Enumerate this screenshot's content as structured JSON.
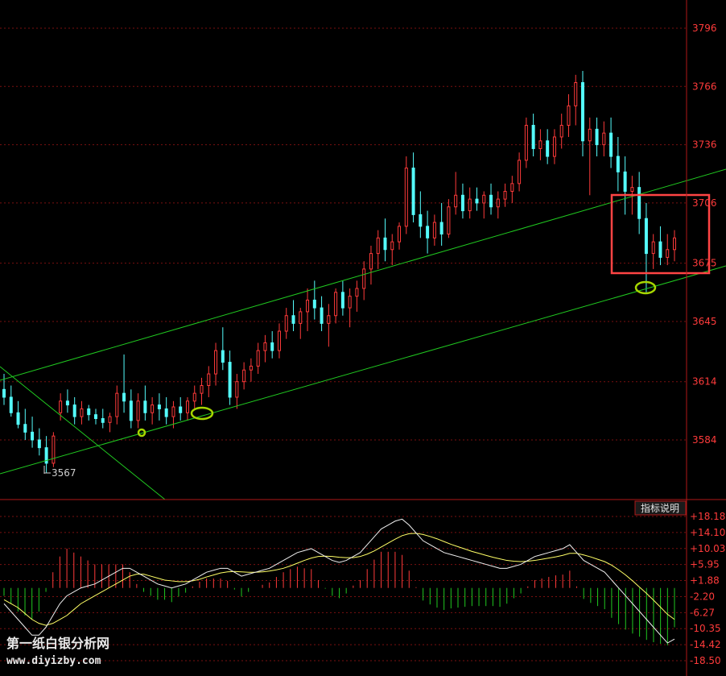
{
  "chart_data": [
    {
      "type": "candlestick",
      "title": "",
      "ylim": [
        3550,
        3810
      ],
      "grid": true,
      "y_ticks": [
        "3796",
        "3766",
        "3736",
        "3706",
        "3675",
        "3645",
        "3614",
        "3584"
      ],
      "low_marker": "3567",
      "colors": {
        "up": "#ff3a3a",
        "down": "#54fcfc",
        "channel": "#20c820",
        "highlight": "#ff4444",
        "circle": "#a6d600",
        "axis_text": "#ff3b3b"
      },
      "candles": [
        [
          3610,
          3618,
          3602,
          3606
        ],
        [
          3606,
          3612,
          3596,
          3598
        ],
        [
          3598,
          3604,
          3590,
          3592
        ],
        [
          3592,
          3600,
          3584,
          3588
        ],
        [
          3588,
          3596,
          3580,
          3584
        ],
        [
          3584,
          3590,
          3576,
          3580
        ],
        [
          3580,
          3586,
          3567,
          3572
        ],
        [
          3572,
          3588,
          3570,
          3586
        ],
        [
          3598,
          3608,
          3594,
          3604
        ],
        [
          3604,
          3610,
          3598,
          3602
        ],
        [
          3602,
          3606,
          3592,
          3596
        ],
        [
          3596,
          3604,
          3592,
          3600
        ],
        [
          3600,
          3602,
          3594,
          3597
        ],
        [
          3597,
          3600,
          3592,
          3595
        ],
        [
          3595,
          3600,
          3590,
          3593
        ],
        [
          3593,
          3598,
          3588,
          3596
        ],
        [
          3596,
          3612,
          3592,
          3608
        ],
        [
          3608,
          3628,
          3598,
          3604
        ],
        [
          3604,
          3610,
          3590,
          3594
        ],
        [
          3594,
          3608,
          3590,
          3604
        ],
        [
          3604,
          3612,
          3594,
          3598
        ],
        [
          3598,
          3606,
          3592,
          3602
        ],
        [
          3602,
          3608,
          3594,
          3600
        ],
        [
          3600,
          3606,
          3592,
          3596
        ],
        [
          3596,
          3604,
          3590,
          3601
        ],
        [
          3601,
          3606,
          3594,
          3598
        ],
        [
          3598,
          3606,
          3594,
          3604
        ],
        [
          3604,
          3612,
          3600,
          3608
        ],
        [
          3608,
          3616,
          3602,
          3612
        ],
        [
          3612,
          3622,
          3606,
          3618
        ],
        [
          3618,
          3634,
          3612,
          3630
        ],
        [
          3630,
          3642,
          3620,
          3624
        ],
        [
          3624,
          3630,
          3602,
          3606
        ],
        [
          3606,
          3618,
          3600,
          3614
        ],
        [
          3614,
          3624,
          3610,
          3620
        ],
        [
          3620,
          3626,
          3614,
          3622
        ],
        [
          3622,
          3634,
          3618,
          3630
        ],
        [
          3630,
          3638,
          3624,
          3634
        ],
        [
          3634,
          3640,
          3626,
          3630
        ],
        [
          3630,
          3644,
          3626,
          3640
        ],
        [
          3640,
          3652,
          3636,
          3648
        ],
        [
          3648,
          3656,
          3640,
          3644
        ],
        [
          3644,
          3652,
          3636,
          3650
        ],
        [
          3650,
          3662,
          3640,
          3656
        ],
        [
          3656,
          3666,
          3646,
          3652
        ],
        [
          3652,
          3658,
          3640,
          3644
        ],
        [
          3644,
          3654,
          3632,
          3648
        ],
        [
          3648,
          3662,
          3644,
          3660
        ],
        [
          3660,
          3666,
          3648,
          3652
        ],
        [
          3652,
          3662,
          3642,
          3658
        ],
        [
          3658,
          3666,
          3650,
          3662
        ],
        [
          3662,
          3676,
          3656,
          3672
        ],
        [
          3672,
          3684,
          3664,
          3680
        ],
        [
          3680,
          3692,
          3672,
          3688
        ],
        [
          3688,
          3698,
          3676,
          3682
        ],
        [
          3682,
          3690,
          3674,
          3686
        ],
        [
          3686,
          3696,
          3682,
          3694
        ],
        [
          3694,
          3730,
          3690,
          3724
        ],
        [
          3724,
          3732,
          3696,
          3700
        ],
        [
          3700,
          3712,
          3688,
          3694
        ],
        [
          3694,
          3702,
          3680,
          3688
        ],
        [
          3688,
          3700,
          3684,
          3696
        ],
        [
          3696,
          3706,
          3684,
          3690
        ],
        [
          3690,
          3708,
          3688,
          3704
        ],
        [
          3704,
          3722,
          3700,
          3710
        ],
        [
          3710,
          3716,
          3698,
          3702
        ],
        [
          3702,
          3714,
          3698,
          3708
        ],
        [
          3708,
          3714,
          3702,
          3706
        ],
        [
          3706,
          3712,
          3698,
          3710
        ],
        [
          3710,
          3716,
          3700,
          3704
        ],
        [
          3704,
          3712,
          3698,
          3708
        ],
        [
          3708,
          3716,
          3704,
          3712
        ],
        [
          3712,
          3720,
          3706,
          3716
        ],
        [
          3716,
          3732,
          3712,
          3728
        ],
        [
          3728,
          3750,
          3724,
          3746
        ],
        [
          3746,
          3752,
          3730,
          3734
        ],
        [
          3734,
          3744,
          3728,
          3738
        ],
        [
          3738,
          3744,
          3726,
          3730
        ],
        [
          3730,
          3744,
          3726,
          3740
        ],
        [
          3740,
          3752,
          3734,
          3746
        ],
        [
          3746,
          3762,
          3740,
          3756
        ],
        [
          3756,
          3772,
          3746,
          3768
        ],
        [
          3768,
          3774,
          3730,
          3738
        ],
        [
          3738,
          3750,
          3710,
          3744
        ],
        [
          3744,
          3750,
          3730,
          3736
        ],
        [
          3736,
          3748,
          3730,
          3742
        ],
        [
          3742,
          3750,
          3724,
          3730
        ],
        [
          3730,
          3740,
          3712,
          3722
        ],
        [
          3722,
          3730,
          3700,
          3712
        ],
        [
          3712,
          3720,
          3700,
          3714
        ],
        [
          3714,
          3722,
          3690,
          3698
        ],
        [
          3698,
          3706,
          3660,
          3680
        ],
        [
          3680,
          3690,
          3672,
          3686
        ],
        [
          3686,
          3694,
          3674,
          3678
        ],
        [
          3678,
          3690,
          3674,
          3682
        ],
        [
          3682,
          3692,
          3676,
          3688
        ]
      ]
    },
    {
      "type": "macd",
      "ylim": [
        -18.5,
        18.18
      ],
      "y_ticks": [
        "+18.18",
        "+14.10",
        "+10.03",
        "+5.95",
        "+1.88",
        "-2.20",
        "-6.27",
        "-10.35",
        "-14.42",
        "-18.50"
      ],
      "button_label": "指标说明",
      "colors": {
        "pos": "#ff3a3a",
        "neg": "#20c820",
        "dif": "#f0f0f0",
        "dea": "#ffff66",
        "axis_text": "#ff3b3b"
      },
      "dif": [
        -4,
        -6,
        -8,
        -10,
        -12,
        -12,
        -10,
        -7,
        -4,
        -2,
        -1,
        0,
        0.5,
        1,
        2,
        3,
        4,
        5,
        5,
        4,
        3,
        2,
        1,
        0.5,
        0,
        0.5,
        1,
        2,
        3,
        4,
        4.5,
        5,
        5,
        4,
        3,
        3.5,
        4,
        4.5,
        5,
        6,
        7,
        8,
        9,
        9.5,
        10,
        9,
        8,
        7,
        6.5,
        7,
        8,
        9,
        11,
        13,
        15,
        16,
        17,
        17.5,
        16,
        14,
        12,
        11,
        10,
        9,
        8.5,
        8,
        7.5,
        7,
        6.5,
        6,
        5.5,
        5,
        5,
        5.5,
        6,
        7,
        8,
        8.5,
        9,
        9.5,
        10,
        11,
        9,
        7,
        6,
        5,
        4,
        2,
        0,
        -2,
        -4,
        -6,
        -8,
        -10,
        -12,
        -14,
        -13
      ],
      "dea": [
        -3,
        -4,
        -5,
        -6.5,
        -8,
        -9,
        -9.5,
        -9,
        -8,
        -7,
        -5.5,
        -4,
        -3,
        -2,
        -1,
        0,
        1,
        2,
        3,
        3.5,
        3.5,
        3,
        2.5,
        2,
        1.8,
        1.6,
        1.6,
        1.8,
        2.2,
        2.8,
        3.3,
        3.8,
        4.1,
        4.2,
        4.1,
        4,
        4,
        4.1,
        4.3,
        4.6,
        5,
        5.6,
        6.3,
        7,
        7.6,
        8,
        8.1,
        8,
        7.8,
        7.7,
        7.7,
        8,
        8.6,
        9.4,
        10.4,
        11.4,
        12.4,
        13.3,
        13.8,
        13.9,
        13.6,
        13.1,
        12.5,
        11.8,
        11.1,
        10.5,
        9.9,
        9.3,
        8.8,
        8.3,
        7.8,
        7.4,
        7,
        6.8,
        6.7,
        6.8,
        7,
        7.3,
        7.6,
        7.9,
        8.3,
        8.8,
        8.8,
        8.4,
        7.9,
        7.3,
        6.7,
        5.8,
        4.6,
        3.3,
        1.8,
        0.2,
        -1.4,
        -3.1,
        -4.9,
        -6.7,
        -8
      ]
    }
  ],
  "watermark": {
    "line1": "第一纸白银分析网",
    "line2": "www.diyizby.com"
  }
}
